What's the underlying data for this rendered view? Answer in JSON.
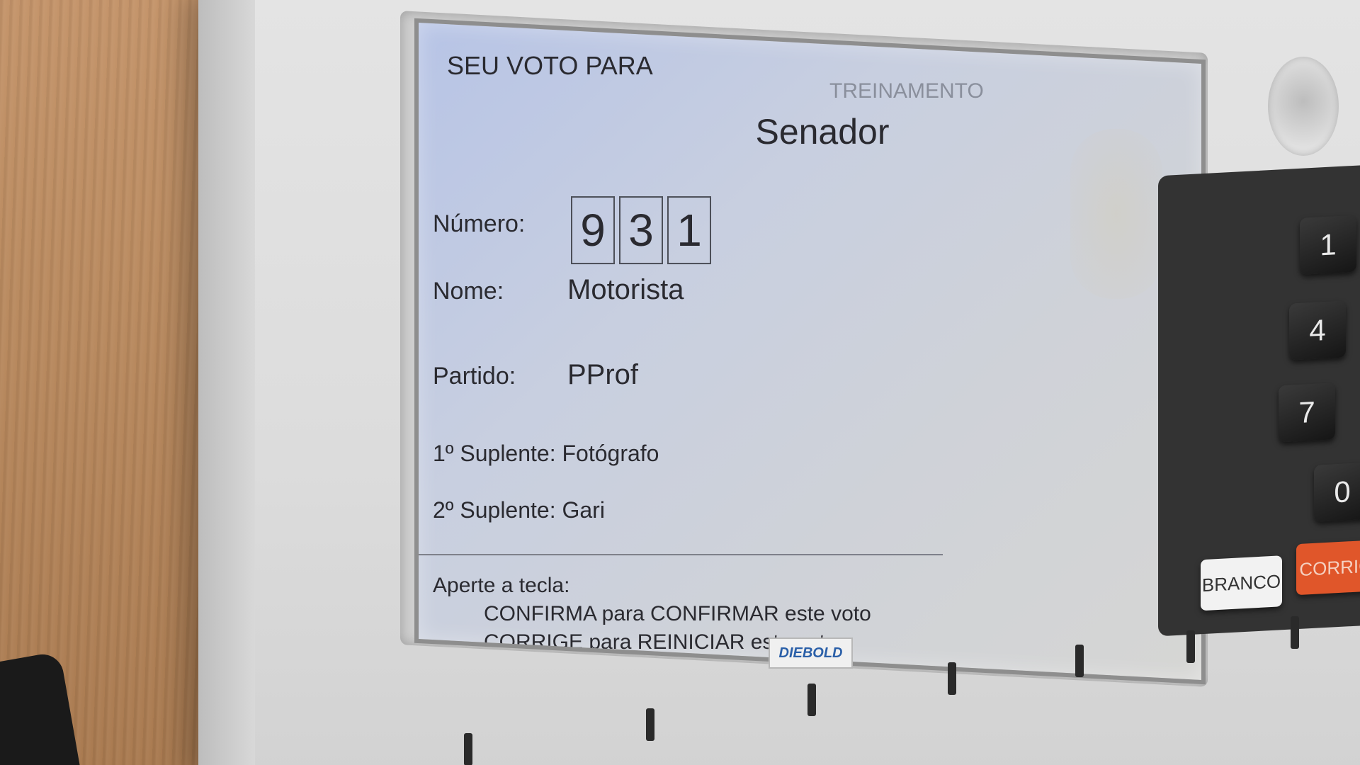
{
  "screen": {
    "header_label": "SEU VOTO PARA",
    "mode_label": "TREINAMENTO",
    "office": "Senador",
    "numero_label": "Número:",
    "digits": [
      "9",
      "3",
      "1"
    ],
    "nome_label": "Nome:",
    "nome_value": "Motorista",
    "partido_label": "Partido:",
    "partido_value": "PProf",
    "suplente1": "1º Suplente: Fotógrafo",
    "suplente2": "2º Suplente: Gari",
    "instructions": {
      "line1": "Aperte a tecla:",
      "line2": "CONFIRMA para CONFIRMAR este voto",
      "line3": "CORRIGE para REINICIAR este voto"
    }
  },
  "keypad": {
    "keys": [
      "1",
      "4",
      "7",
      "0"
    ],
    "branco_label": "BRANCO",
    "corrige_label": "CORRIGE"
  },
  "brand": "DIEBOLD"
}
